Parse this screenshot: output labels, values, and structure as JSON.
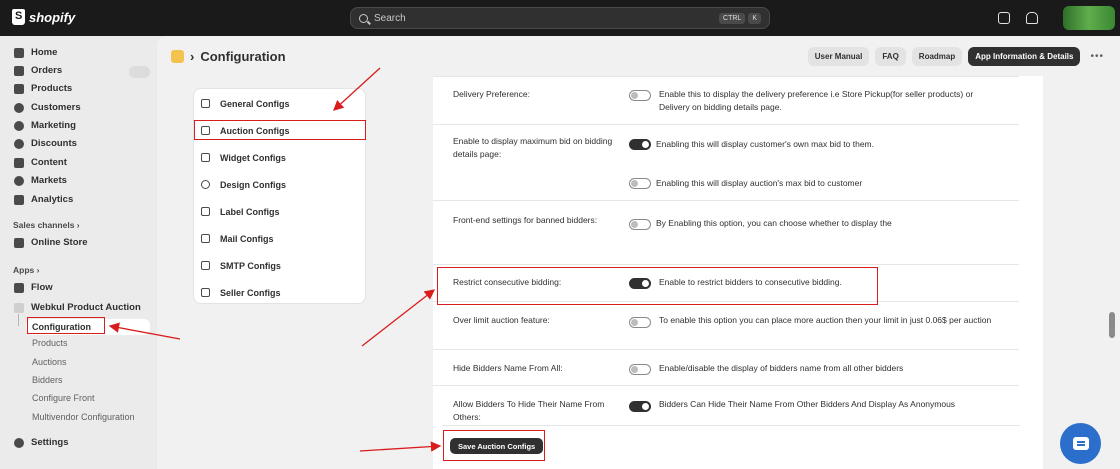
{
  "topbar": {
    "brand": "shopify",
    "search_placeholder": "Search",
    "kbd": [
      "CTRL",
      "K"
    ]
  },
  "sidebar": {
    "items": [
      {
        "label": "Home",
        "icon": "home-icon"
      },
      {
        "label": "Orders",
        "icon": "orders-icon"
      },
      {
        "label": "Products",
        "icon": "tag-icon"
      },
      {
        "label": "Customers",
        "icon": "person-icon"
      },
      {
        "label": "Marketing",
        "icon": "target-icon"
      },
      {
        "label": "Discounts",
        "icon": "discount-icon"
      },
      {
        "label": "Content",
        "icon": "content-icon"
      },
      {
        "label": "Markets",
        "icon": "globe-icon"
      },
      {
        "label": "Analytics",
        "icon": "chart-icon"
      }
    ],
    "sales_channels_label": "Sales channels ›",
    "online_store": "Online Store",
    "apps_label": "Apps ›",
    "flow": "Flow",
    "app_name": "Webkul Product Auction",
    "app_sub": [
      "Configuration",
      "Products",
      "Auctions",
      "Bidders",
      "Configure Front",
      "Multivendor Configuration"
    ],
    "settings": "Settings"
  },
  "header": {
    "breadcrumb_sep": "›",
    "title": "Configuration",
    "buttons": [
      "User Manual",
      "FAQ",
      "Roadmap",
      "App Information & Details"
    ],
    "more": "•••"
  },
  "config_menu": [
    "General Configs",
    "Auction Configs",
    "Widget Configs",
    "Design Configs",
    "Label Configs",
    "Mail Configs",
    "SMTP Configs",
    "Seller Configs"
  ],
  "settings_rows": [
    {
      "label": "Delivery Preference:",
      "desc": "Enable this to display the delivery preference i.e Store Pickup(for seller products) or Delivery on bidding details page.",
      "on": false
    },
    {
      "label": "Enable to display maximum bid on bidding details page:",
      "desc": "Enabling this will display customer's own max bid to them.",
      "on": true
    },
    {
      "label": "",
      "desc": "Enabling this will display auction's max bid to customer",
      "on": false
    },
    {
      "label": "Front-end settings for banned bidders:",
      "desc": "By Enabling this option, you can choose whether to display the",
      "on": false
    },
    {
      "label": "Restrict consecutive bidding:",
      "desc": "Enable to restrict bidders to consecutive bidding.",
      "on": true
    },
    {
      "label": "Over limit auction feature:",
      "desc": "To enable this option you can place more auction then your limit in just 0.06$ per auction",
      "on": false
    },
    {
      "label": "Hide Bidders Name From All:",
      "desc": "Enable/disable the display of bidders name from all other bidders",
      "on": false
    },
    {
      "label": "Allow Bidders To Hide Their Name From Others:",
      "desc": "Bidders Can Hide Their Name From Other Bidders And Display As Anonymous",
      "on": true
    }
  ],
  "save_button": "Save Auction Configs",
  "colors": {
    "annotation": "#d91c1c",
    "topbar": "#1a1a1a",
    "primary": "#303030",
    "chat": "#2c6ecb"
  }
}
